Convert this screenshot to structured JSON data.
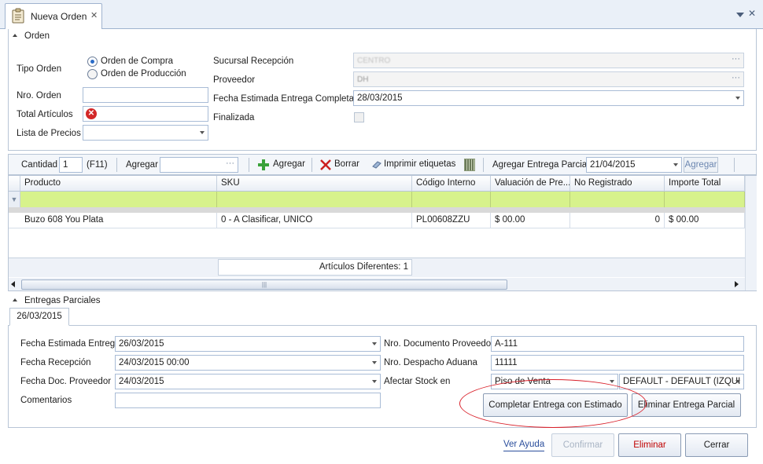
{
  "tab": {
    "title": "Nueva Orden",
    "close": "✕"
  },
  "orden": {
    "section_title": "Orden",
    "tipo_orden_label": "Tipo Orden",
    "radio_compra": "Orden de Compra",
    "radio_produccion": "Orden de Producción",
    "selected_tipo": "Orden de Compra",
    "nro_orden_label": "Nro. Orden",
    "nro_orden_value": "",
    "total_articulos_label": "Total Artículos",
    "total_articulos_value": "",
    "lista_precios_label": "Lista de Precios",
    "lista_precios_value": "",
    "sucursal_label": "Sucursal Recepción",
    "sucursal_value": "CENTRO",
    "proveedor_label": "Proveedor",
    "proveedor_value": "DH",
    "fecha_estimada_label": "Fecha Estimada Entrega Completa",
    "fecha_estimada_value": "28/03/2015",
    "finalizada_label": "Finalizada",
    "finalizada_checked": false
  },
  "toolbar": {
    "cantidad_label": "Cantidad",
    "cantidad_value": "1",
    "f11": "(F11)",
    "agregar_label": "Agregar",
    "agregar_input": "",
    "agregar_btn": "Agregar",
    "borrar_btn": "Borrar",
    "imprimir_btn": "Imprimir etiquetas",
    "entrega_parcial_label": "Agregar Entrega Parcial",
    "entrega_parcial_date": "21/04/2015",
    "entrega_parcial_btn": "Agregar"
  },
  "grid": {
    "columns": [
      "Producto",
      "SKU",
      "Código Interno",
      "Valuación de Pre...",
      "No Registrado",
      "Importe Total"
    ],
    "rows": [
      [
        "Buzo 608 You Plata",
        "0 - A Clasificar, UNICO",
        "PL00608ZZU",
        "$ 00.00",
        "0",
        "$ 00.00"
      ]
    ],
    "footer": "Artículos Diferentes: 1"
  },
  "entregas": {
    "section_title": "Entregas Parciales",
    "tab_label": "26/03/2015",
    "fecha_estimada_label": "Fecha Estimada Entrega",
    "fecha_estimada_value": "26/03/2015",
    "fecha_recepcion_label": "Fecha Recepción",
    "fecha_recepcion_value": "24/03/2015 00:00",
    "fecha_doc_label": "Fecha Doc. Proveedor",
    "fecha_doc_value": "24/03/2015",
    "comentarios_label": "Comentarios",
    "comentarios_value": "",
    "nro_doc_label": "Nro. Documento Proveedor",
    "nro_doc_value": "A-111",
    "nro_despacho_label": "Nro. Despacho Aduana",
    "nro_despacho_value": "11111",
    "afectar_stock_label": "Afectar Stock en",
    "afectar_stock_value": "Piso de Venta",
    "deposito_value": "DEFAULT - DEFAULT (IZQUI",
    "completar_btn": "Completar Entrega con Estimado",
    "eliminar_parcial_btn": "Eliminar Entrega Parcial"
  },
  "footer": {
    "ayuda": "Ver Ayuda",
    "confirmar": "Confirmar",
    "eliminar": "Eliminar",
    "cerrar": "Cerrar"
  },
  "colors": {
    "accent_blue": "#2b4e9c",
    "filter_green": "#d7f28c",
    "annotation_red": "#d9202a",
    "delete_red": "#c00000"
  }
}
